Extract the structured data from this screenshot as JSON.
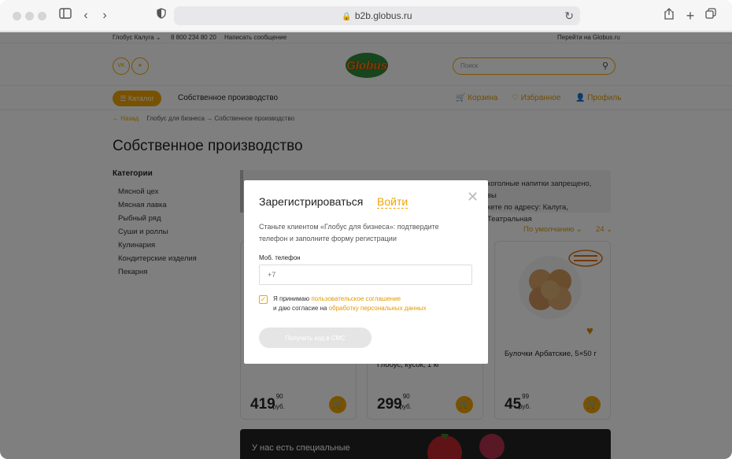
{
  "browser": {
    "url": "b2b.globus.ru"
  },
  "topstrip": {
    "city": "Глобус Калуга",
    "phone": "8 800 234 80 20",
    "write": "Написать сообщение",
    "goto": "Перейти на Globus.ru"
  },
  "header": {
    "logo_text": "Globus",
    "search_placeholder": "Поиск"
  },
  "nav": {
    "catalog": "Каталог",
    "own": "Собственное производство",
    "cart": "Корзина",
    "fav": "Избранное",
    "profile": "Профиль"
  },
  "breadcrumbs": {
    "back": "← Назад",
    "path": "Глобус для бизнеса → Собственное производство"
  },
  "page_title": "Собственное производство",
  "categories": {
    "title": "Категории",
    "items": [
      "Мясной цех",
      "Мясная лавка",
      "Рыбный ряд",
      "Суши и роллы",
      "Кулинария",
      "Кондитерские изделия",
      "Пекарня"
    ]
  },
  "notice": {
    "line1": "коголные напитки запрещено, вы",
    "line2": "кете по адресу: Калуга, Театральная"
  },
  "sort": {
    "label": "По умолчанию ⌄",
    "count": "24 ⌄"
  },
  "products": [
    {
      "name": "",
      "price_int": "419",
      "price_frac": "90",
      "currency": "руб."
    },
    {
      "name": "Глобус, кусок, 1 кг",
      "price_int": "299",
      "price_frac": "90",
      "currency": "руб."
    },
    {
      "name": "Булочки Арбатские, 5×50 г",
      "price_int": "45",
      "price_frac": "99",
      "currency": "руб."
    }
  ],
  "banner": {
    "text": "У нас есть специальные"
  },
  "modal": {
    "title": "Зарегистрироваться",
    "login_link": "Войти",
    "description": "Станьте клиентом «Глобус для бизнеса»: подтвердите телефон и заполните форму регистрации",
    "phone_label": "Моб. телефон",
    "phone_placeholder": "+7",
    "agree_prefix": "Я принимаю ",
    "agree_link1": "пользовательское соглашение",
    "agree_mid": "и даю согласие на ",
    "agree_link2": "обработку персональных данных",
    "submit": "Получить код в СМС"
  },
  "colors": {
    "accent": "#f0a500",
    "overlay": "rgba(0,0,0,0.5)"
  }
}
